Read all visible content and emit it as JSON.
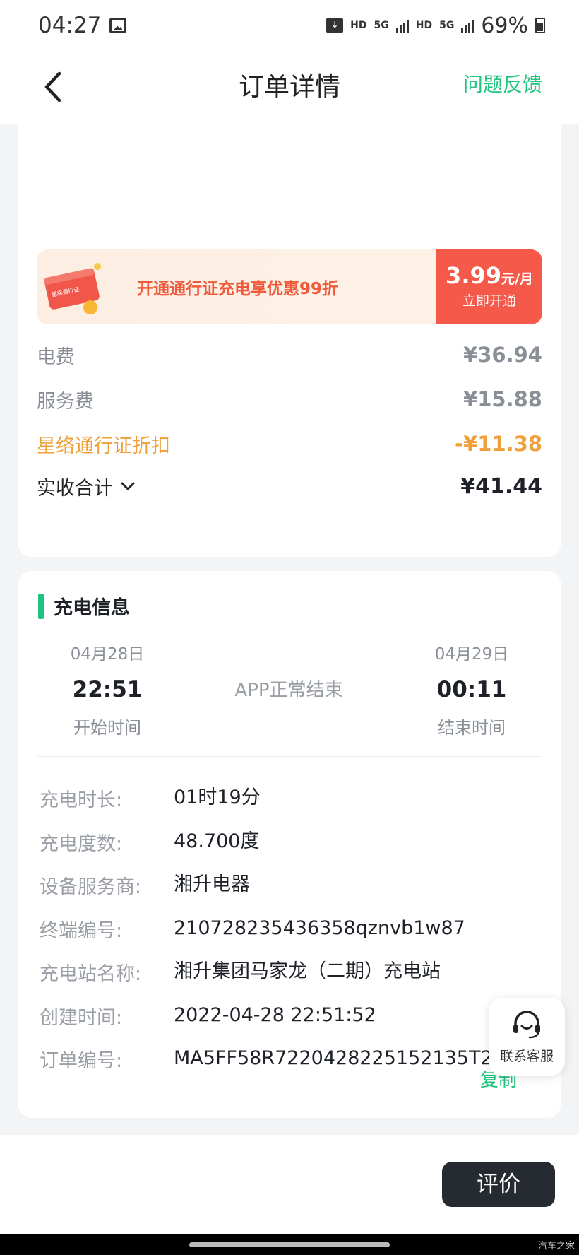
{
  "status_bar": {
    "time": "04:27",
    "net1": "HD",
    "net1_type": "5G",
    "net2": "HD",
    "net2_type": "5G",
    "battery": "69%",
    "icons": [
      "image-icon",
      "message-icon",
      "signal-icon",
      "battery-icon"
    ]
  },
  "nav": {
    "title": "订单详情",
    "feedback": "问题反馈"
  },
  "promo": {
    "card_caption": "星络通行证",
    "text": "开通通行证充电享优惠99折",
    "price": "3.99",
    "unit": "元/月",
    "action": "立即开通"
  },
  "fees": {
    "electricity_label": "电费",
    "electricity_value": "¥36.94",
    "service_label": "服务费",
    "service_value": "¥15.88",
    "discount_label": "星络通行证折扣",
    "discount_value": "-¥11.38",
    "total_label": "实收合计",
    "total_value": "¥41.44"
  },
  "charge_info": {
    "title": "充电信息",
    "start_date": "04月28日",
    "start_time": "22:51",
    "start_label": "开始时间",
    "end_reason": "APP正常结束",
    "end_date": "04月29日",
    "end_time": "00:11",
    "end_label": "结束时间",
    "rows": [
      {
        "label": "充电时长:",
        "value": "01时19分"
      },
      {
        "label": "充电度数:",
        "value": "48.700度"
      },
      {
        "label": "设备服务商:",
        "value": "湘升电器"
      },
      {
        "label": "终端编号:",
        "value": "210728235436358qznvb1w87"
      },
      {
        "label": "充电站名称:",
        "value": "湘升集团马家龙（二期）充电站"
      },
      {
        "label": "创建时间:",
        "value": "2022-04-28 22:51:52"
      },
      {
        "label": "订单编号:",
        "value": "MA5FF58R7220428225152135T2r"
      }
    ],
    "copy": "复制"
  },
  "float": {
    "service_label": "联系客服"
  },
  "bottom": {
    "review": "评价"
  },
  "watermark": "汽车之家",
  "colors": {
    "accent": "#1fc47e",
    "promo_red": "#f4594a",
    "discount": "#f0a03a",
    "button_dark": "#262b31"
  }
}
